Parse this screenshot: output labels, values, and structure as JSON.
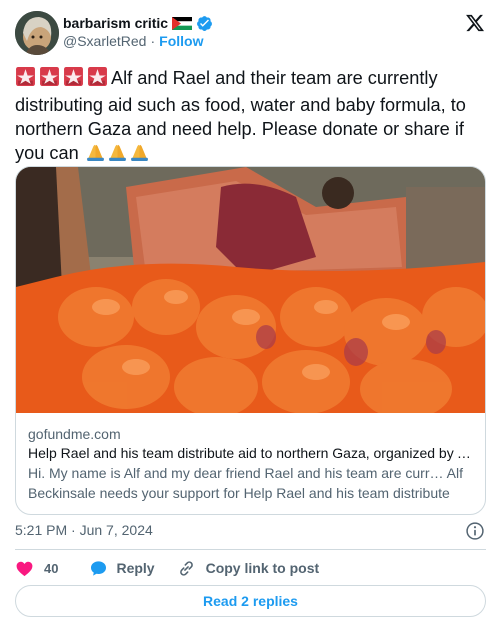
{
  "author": {
    "display_name": "barbarism critic",
    "handle": "@SxarletRed",
    "separator": "·",
    "follow_label": "Follow",
    "avatar_icon": "avatar-portrait",
    "flag_icon": "palestine-flag",
    "verified_icon": "verified-badge"
  },
  "tweet": {
    "text": "Alf and Rael and their team are currently distributing aid such as food, water and baby formula, to northern Gaza and need help. Please donate or share if you can ",
    "leading_emoji": "police-light-icon x4",
    "trailing_emoji": "folded-hands-icon x3"
  },
  "link_card": {
    "domain": "gofundme.com",
    "title": "Help Rael and his team distribute aid to northern Gaza, organized by Alf Beckinsale",
    "description": "Hi. My name is Alf and my dear friend Rael and his team are curr… Alf Beckinsale needs your support for Help Rael and his team distribute ai…"
  },
  "timestamp": {
    "time": "5:21 PM",
    "separator": "·",
    "date": "Jun 7, 2024"
  },
  "actions": {
    "like_count": "40",
    "reply_label": "Reply",
    "copy_label": "Copy link to post"
  },
  "read_replies_label": "Read 2 replies",
  "colors": {
    "accent": "#1d9bf0",
    "like": "#f91880",
    "text_primary": "#0f1419",
    "text_secondary": "#536471",
    "border": "#cfd9de"
  }
}
